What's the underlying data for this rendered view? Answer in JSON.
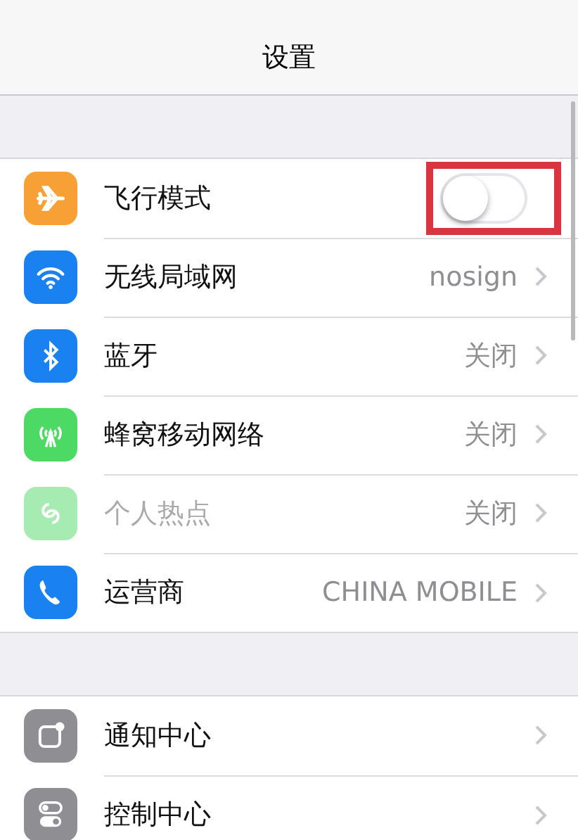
{
  "nav_bar": {
    "title": "设置"
  },
  "groups": [
    {
      "items": [
        {
          "kind": "toggle",
          "label": "飞行模式",
          "color": "#f7a035",
          "on": false,
          "highlighted": true,
          "disabled": false
        },
        {
          "kind": "detail",
          "label": "无线局域网",
          "value": "nosign",
          "color": "#1a82f0",
          "disabled": false
        },
        {
          "kind": "detail",
          "label": "蓝牙",
          "value": "关闭",
          "color": "#1a82f0",
          "disabled": false
        },
        {
          "kind": "detail",
          "label": "蜂窝移动网络",
          "value": "关闭",
          "color": "#4cd964",
          "disabled": false
        },
        {
          "kind": "detail",
          "label": "个人热点",
          "value": "关闭",
          "color": "#a6ebb1",
          "disabled": true
        },
        {
          "kind": "detail",
          "label": "运营商",
          "value": "CHINA MOBILE",
          "color": "#1a82f0",
          "disabled": false
        }
      ]
    },
    {
      "items": [
        {
          "kind": "detail",
          "label": "通知中心",
          "color": "#8e8e93",
          "disabled": false
        },
        {
          "kind": "detail",
          "label": "控制中心",
          "color": "#8e8e93",
          "disabled": false
        }
      ]
    }
  ]
}
